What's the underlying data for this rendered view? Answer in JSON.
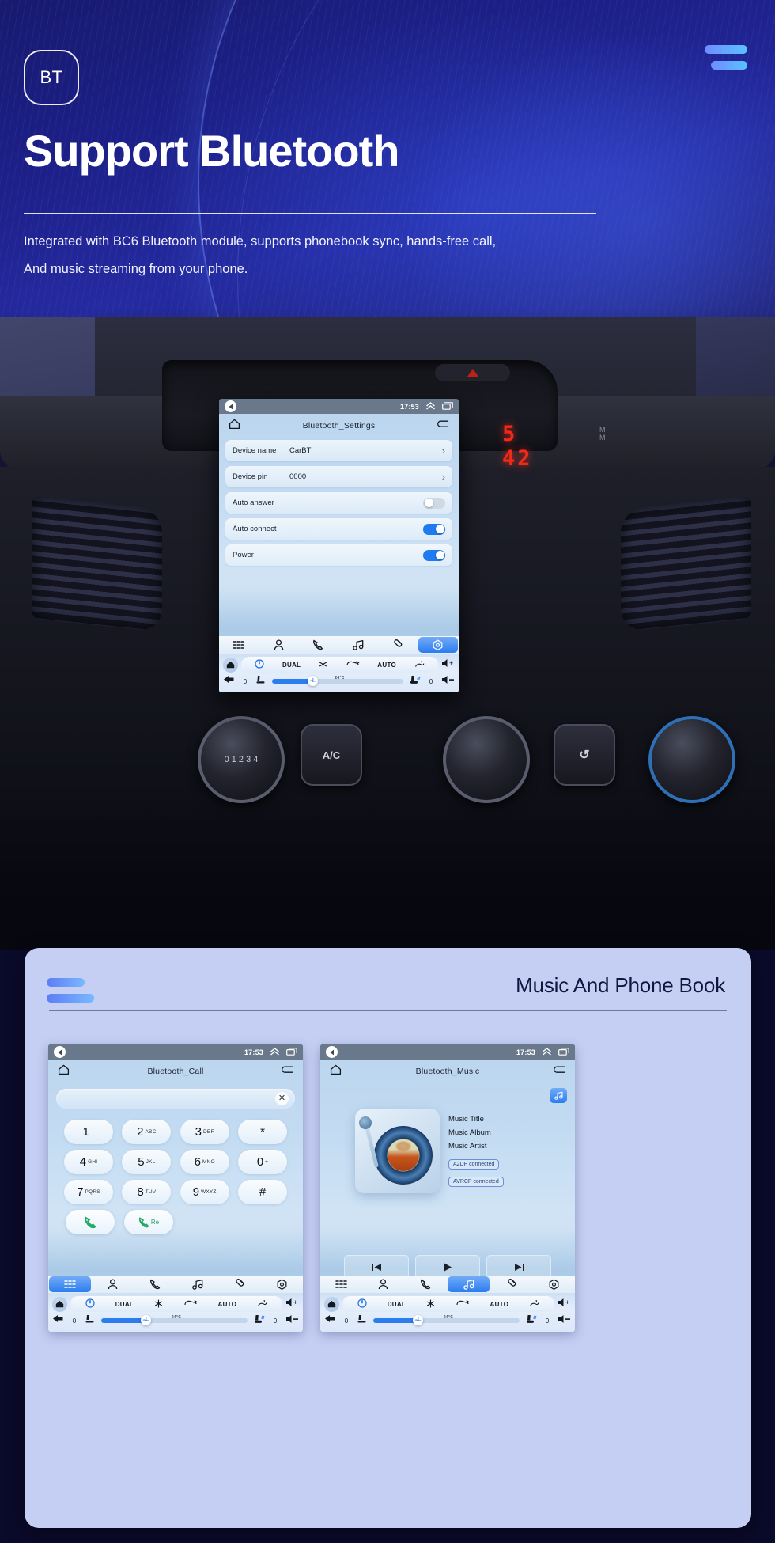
{
  "hero": {
    "badge": "BT",
    "title": "Support Bluetooth",
    "subtitle_line1": "Integrated with BC6 Bluetooth module, supports phonebook sync, hands-free call,",
    "subtitle_line2": "And music streaming from your phone.",
    "menu_icon": "hamburger-icon"
  },
  "car": {
    "led_clock": "5 42",
    "ac_button_label": "A/C"
  },
  "settings_unit": {
    "statusbar": {
      "time": "17:53",
      "back_icon": "back-arrow-icon",
      "expand_icon": "chevron-up-icon",
      "recents_icon": "recents-icon"
    },
    "app_title": "Bluetooth_Settings",
    "home_icon": "home-icon",
    "return_icon": "return-icon",
    "rows": [
      {
        "label": "Device name",
        "value": "CarBT",
        "control": "chevron"
      },
      {
        "label": "Device pin",
        "value": "0000",
        "control": "chevron"
      },
      {
        "label": "Auto answer",
        "value": "",
        "control": "toggle",
        "state": "off"
      },
      {
        "label": "Auto connect",
        "value": "",
        "control": "toggle",
        "state": "on"
      },
      {
        "label": "Power",
        "value": "",
        "control": "toggle",
        "state": "on"
      }
    ],
    "tabs": [
      {
        "icon": "dialpad-icon",
        "active": false
      },
      {
        "icon": "contacts-icon",
        "active": false
      },
      {
        "icon": "phone-icon",
        "active": false
      },
      {
        "icon": "music-icon",
        "active": false
      },
      {
        "icon": "link-icon",
        "active": false
      },
      {
        "icon": "settings-icon",
        "active": true
      }
    ],
    "climate": {
      "dual": "DUAL",
      "auto": "AUTO",
      "temp": "24°C",
      "left_value": "0",
      "right_value": "0",
      "power_icon": "power-icon",
      "snow_icon": "snowflake-icon",
      "recirc_icon": "recirculate-icon",
      "defrost_icon": "defrost-icon",
      "vol_up_icon": "volume-up-icon",
      "vol_down_icon": "volume-down-icon",
      "home_icon": "home-icon",
      "back_icon": "back-arrow-icon",
      "seat_icon": "seat-icon",
      "seat_heat_icon": "seat-heat-icon",
      "fan_icon": "fan-icon"
    }
  },
  "card": {
    "title": "Music And Phone Book"
  },
  "call_unit": {
    "statusbar": {
      "time": "17:53"
    },
    "app_title": "Bluetooth_Call",
    "search_value": "",
    "clear_icon": "close-icon",
    "keys": [
      [
        {
          "num": "1",
          "sub": "--"
        },
        {
          "num": "2",
          "sub": "ABC"
        },
        {
          "num": "3",
          "sub": "DEF"
        },
        {
          "num": "*",
          "sub": ""
        }
      ],
      [
        {
          "num": "4",
          "sub": "GHI"
        },
        {
          "num": "5",
          "sub": "JKL"
        },
        {
          "num": "6",
          "sub": "MNO"
        },
        {
          "num": "0",
          "sub": "+"
        }
      ],
      [
        {
          "num": "7",
          "sub": "PQRS"
        },
        {
          "num": "8",
          "sub": "TUV"
        },
        {
          "num": "9",
          "sub": "WXYZ"
        },
        {
          "num": "#",
          "sub": ""
        }
      ]
    ],
    "call_button": "call-icon",
    "redial_button_label": "Re",
    "tabs": [
      {
        "icon": "dialpad-icon",
        "active": true
      },
      {
        "icon": "contacts-icon",
        "active": false
      },
      {
        "icon": "phone-icon",
        "active": false
      },
      {
        "icon": "music-icon",
        "active": false
      },
      {
        "icon": "link-icon",
        "active": false
      },
      {
        "icon": "settings-icon",
        "active": false
      }
    ]
  },
  "music_unit": {
    "statusbar": {
      "time": "17:53"
    },
    "app_title": "Bluetooth_Music",
    "title_text": "Music Title",
    "album_text": "Music Album",
    "artist_text": "Music Artist",
    "a2dp_badge": "A2DP  connected",
    "avrcp_badge": "AVRCP connected",
    "prev_icon": "previous-track-icon",
    "play_icon": "play-icon",
    "next_icon": "next-track-icon",
    "tabs": [
      {
        "icon": "dialpad-icon",
        "active": false
      },
      {
        "icon": "contacts-icon",
        "active": false
      },
      {
        "icon": "phone-icon",
        "active": false
      },
      {
        "icon": "music-icon",
        "active": true
      },
      {
        "icon": "link-icon",
        "active": false
      },
      {
        "icon": "settings-icon",
        "active": false
      }
    ]
  },
  "colors": {
    "hero_bg": "#1c1f86",
    "accent_blue": "#2b7df0",
    "card_bg": "#c5cff4",
    "gradient_start": "#5d7df5",
    "gradient_end": "#79b8ff",
    "led_red": "#ff2a18",
    "green": "#23a866"
  }
}
